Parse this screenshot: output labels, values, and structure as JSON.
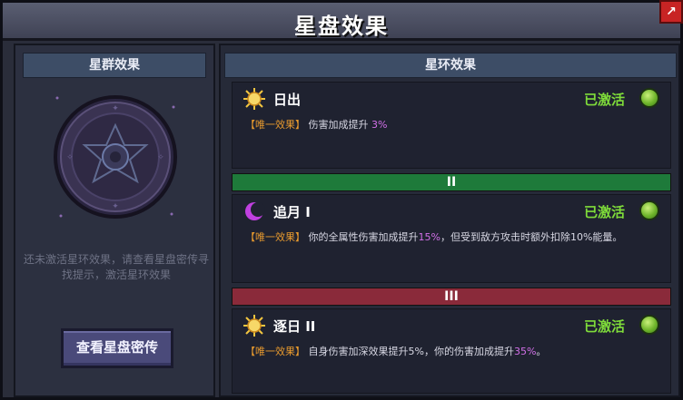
{
  "window": {
    "title": "星盘效果"
  },
  "left": {
    "header": "星群效果",
    "hint": "还未激活星环效果，请查看星盘密传寻找提示，激活星环效果",
    "button_label": "查看星盘密传"
  },
  "right": {
    "header": "星环效果",
    "rings": [
      {
        "icon": "sun-icon",
        "name": "日出",
        "status": "已激活",
        "tag": "【唯一效果】",
        "effect_pre": "伤害加成提升 ",
        "effect_hl": "3%",
        "effect_post": ""
      },
      {
        "icon": "crescent-moon-icon",
        "name": "追月 I",
        "status": "已激活",
        "tag": "【唯一效果】",
        "effect_pre": "你的全属性伤害加成提升",
        "effect_hl": "15%",
        "effect_post": "，但受到敌方攻击时额外扣除10%能量。"
      },
      {
        "icon": "sun-icon",
        "name": "逐日 II",
        "status": "已激活",
        "tag": "【唯一效果】",
        "effect_pre": "自身伤害加深效果提升5%，你的伤害加成提升",
        "effect_hl": "35%",
        "effect_post": "。"
      }
    ],
    "dividers": [
      "II",
      "III"
    ]
  },
  "colors": {
    "accent_green": "#7fdc3a",
    "divider_green": "#1e7a3a",
    "divider_red": "#8a2a3a",
    "highlight": "#d270e8",
    "tag": "#e89a2e"
  }
}
